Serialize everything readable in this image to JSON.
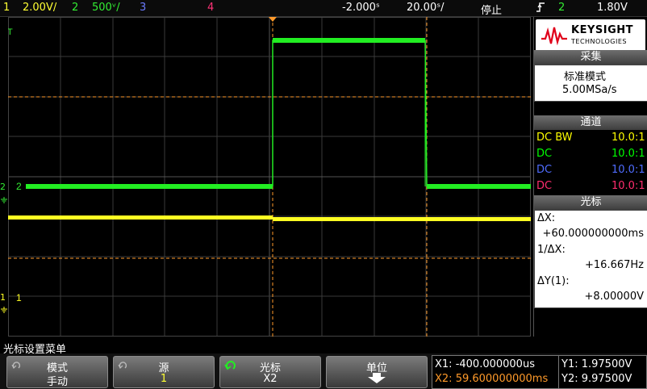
{
  "topbar": {
    "ch1_num": "1",
    "ch1_scale": "2.00V/",
    "ch2_num": "2",
    "ch2_scale": "500ᵛ/",
    "ch3_num": "3",
    "ch4_num": "4",
    "time_offset": "-2.000ˢ",
    "time_scale": "20.00ˢ/",
    "run_state": "停止",
    "trig_channel": "2",
    "trig_level": "1.80V"
  },
  "markers": {
    "ch2": "2",
    "ch1": "1",
    "top": "T"
  },
  "panel": {
    "brand": "KEYSIGHT",
    "brand_sub": "TECHNOLOGIES",
    "acq_header": "采集",
    "acq_mode": "标准模式",
    "acq_rate": "5.00MSa/s",
    "chan_header": "通道",
    "channels": [
      {
        "coupling": "DC BW",
        "probe": "10.0:1",
        "color": "#ffff00"
      },
      {
        "coupling": "DC",
        "probe": "10.0:1",
        "color": "#00ff00"
      },
      {
        "coupling": "DC",
        "probe": "10.0:1",
        "color": "#4f6cff"
      },
      {
        "coupling": "DC",
        "probe": "10.0:1",
        "color": "#ff2d6f"
      }
    ],
    "cursor_header": "光标",
    "dx_label": "ΔX:",
    "dx_value": "+60.000000000ms",
    "inv_dx_label": "1/ΔX:",
    "inv_dx_value": "+16.667Hz",
    "dy_label": "ΔY(1):",
    "dy_value": "+8.00000V"
  },
  "menu": {
    "title": "光标设置菜单",
    "mode_label": "模式",
    "mode_value": "手动",
    "source_label": "源",
    "source_value": "1",
    "cursor_label": "光标",
    "cursor_value": "X2",
    "unit_label": "单位"
  },
  "readouts": {
    "x1": "X1: -400.000000us",
    "x2": "X2: 59.600000000ms",
    "y1": "Y1: 1.97500V",
    "y2": "Y2: 9.97500V"
  },
  "colors": {
    "ch1": "#ffff00",
    "ch2": "#22ee22",
    "ch3": "#4f6cff",
    "ch4": "#ff2d6f",
    "cursor": "#ff9a2a"
  },
  "icons": [
    "keysight-wave-icon",
    "trigger-edge-icon",
    "trigger-marker-icon",
    "refresh-icon",
    "down-arrow-icon",
    "ground-icon"
  ]
}
